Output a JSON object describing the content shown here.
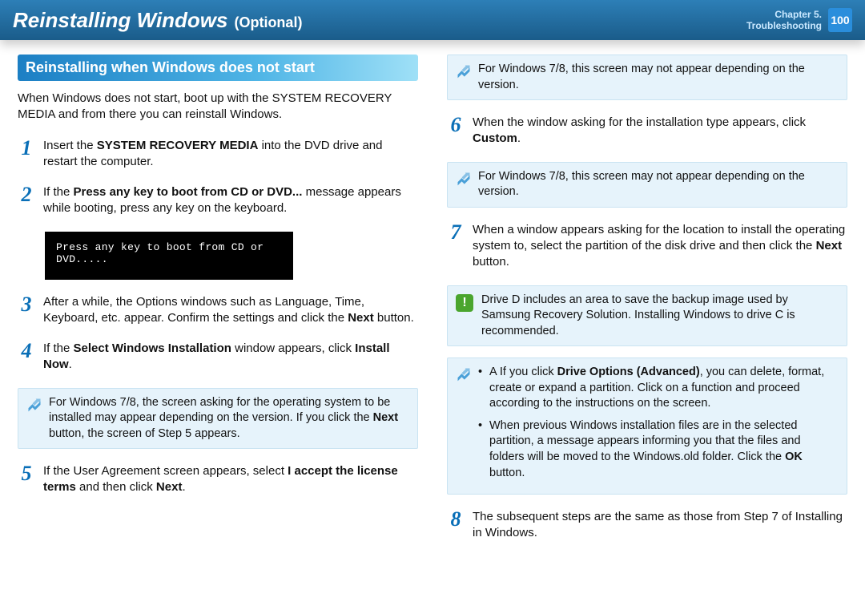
{
  "header": {
    "title_main": "Reinstalling Windows",
    "title_sub": "(Optional)",
    "chapter_line1": "Chapter 5.",
    "chapter_line2": "Troubleshooting",
    "page_number": "100"
  },
  "section_heading": "Reinstalling when Windows does not start",
  "intro": "When Windows does not start, boot up with the SYSTEM RECOVERY MEDIA and from there you can reinstall Windows.",
  "black_screen_text": "Press any key to boot from CD or DVD.....",
  "steps": {
    "s1": {
      "num": "1",
      "pre": "Insert the ",
      "bold": "SYSTEM RECOVERY MEDIA",
      "post": " into the DVD drive and restart the computer."
    },
    "s2": {
      "num": "2",
      "pre": "If the ",
      "bold": "Press any key to boot from CD or DVD...",
      "post": " message appears while booting, press any key on the keyboard."
    },
    "s3": {
      "num": "3",
      "pre": "After a while, the Options windows such as Language, Time, Keyboard, etc. appear. Confirm the settings and click the ",
      "bold": "Next",
      "post": " button."
    },
    "s4": {
      "num": "4",
      "pre": "If the ",
      "bold1": "Select Windows Installation",
      "mid": " window appears, click ",
      "bold2": "Install Now",
      "post": "."
    },
    "s5": {
      "num": "5",
      "pre": "If the User Agreement screen appears, select ",
      "bold1": "I accept the license terms",
      "mid": " and then click ",
      "bold2": "Next",
      "post": "."
    },
    "s6": {
      "num": "6",
      "pre": "When the window asking for the installation type appears, click ",
      "bold": "Custom",
      "post": "."
    },
    "s7": {
      "num": "7",
      "pre": "When a window appears asking for the location to install the operating system to, select the partition of the disk drive and then click the ",
      "bold": "Next",
      "post": " button."
    },
    "s8": {
      "num": "8",
      "text": "The subsequent steps are the same as those from Step 7 of Installing in Windows."
    }
  },
  "notes": {
    "n4": {
      "pre": "For Windows 7/8, the screen asking for the operating system to be installed may appear depending on the version. If you click the ",
      "bold": "Next",
      "post": " button, the screen of Step 5 appears."
    },
    "n5b": "For Windows 7/8, this screen may not appear depending on the version.",
    "n6b": "For Windows 7/8, this screen may not appear depending on the version.",
    "alert": "Drive D includes an area to save the backup image used by Samsung Recovery Solution. Installing Windows to drive C is recommended.",
    "bullets": {
      "b1_pre": "A If you click ",
      "b1_bold": "Drive Options (Advanced)",
      "b1_post": ", you can delete, format, create or expand a partition. Click on a function and proceed according to the instructions on the screen.",
      "b2_pre": "When previous Windows installation files are in the selected partition, a message appears informing you that the files and folders will be moved to the Windows.old folder. Click the ",
      "b2_bold": "OK",
      "b2_post": " button."
    }
  }
}
